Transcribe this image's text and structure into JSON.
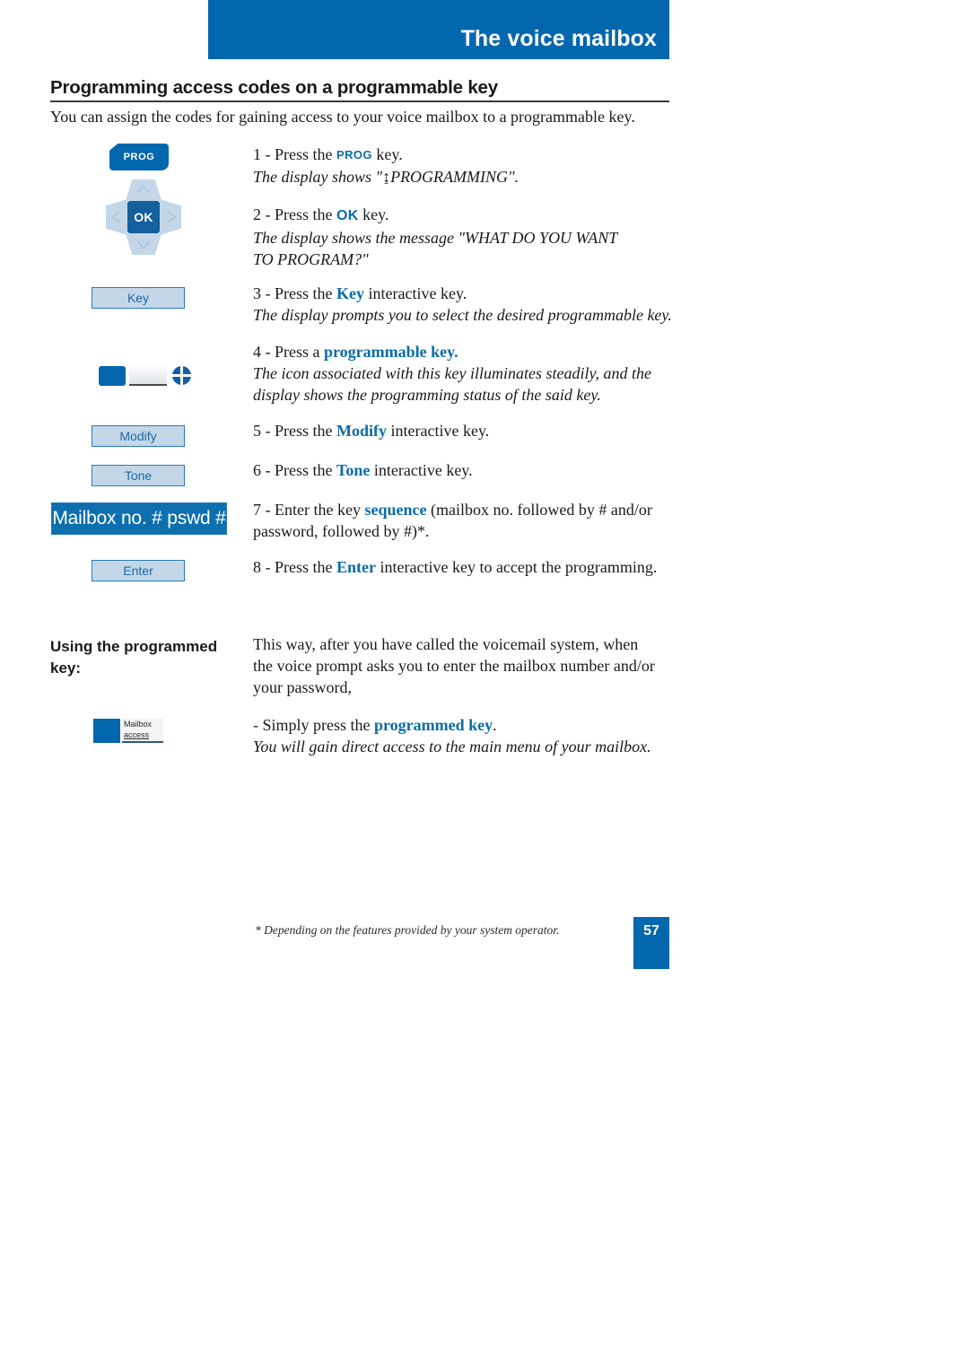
{
  "header": {
    "title": "The voice mailbox",
    "accent_color": "#0267ad"
  },
  "section": {
    "title": "Programming access codes on a programmable key",
    "intro": "You can assign the codes for gaining access to your voice mailbox to a programmable key."
  },
  "icons": {
    "prog_key_label": "PROG",
    "ok_key_label": "OK",
    "nav_up": "up-arrow",
    "nav_down": "down-arrow",
    "nav_left": "left-arrow",
    "nav_right": "right-arrow"
  },
  "softkeys": {
    "key": "Key",
    "modify": "Modify",
    "tone": "Tone",
    "enter": "Enter"
  },
  "display_strip": {
    "text": "Mailbox no. # pswd #"
  },
  "mailbox_key_icon": {
    "line1": "Mailbox",
    "line2": "access"
  },
  "steps": [
    {
      "number": "1",
      "lead_before": "1 - Press the ",
      "inline_key": "PROG",
      "lead_after": " key.",
      "note": "The display shows \"↨PROGRAMMING\"."
    },
    {
      "number": "2",
      "lead_before": "2 - Press the ",
      "inline_key": "OK",
      "lead_after": " key.",
      "note_line1": "The display shows the message \"WHAT DO YOU WANT",
      "note_line2": "TO PROGRAM?\""
    },
    {
      "number": "3",
      "lead_before": "3 - Press the ",
      "keyword": "Key",
      "lead_after": " interactive key.",
      "note": "The display prompts you to select the desired programmable key."
    },
    {
      "number": "4",
      "lead_before": "4 - Press a ",
      "keyword": "programmable key.",
      "lead_after": "",
      "note_line1": "The icon associated with this key illuminates steadily, and the",
      "note_line2": "display shows the programming status of the said key."
    },
    {
      "number": "5",
      "lead_before": "5 - Press the ",
      "keyword": "Modify",
      "lead_after": " interactive key."
    },
    {
      "number": "6",
      "lead_before": "6 - Press the ",
      "keyword": "Tone",
      "lead_after": " interactive key."
    },
    {
      "number": "7",
      "lead_before": "7 - Enter the key ",
      "keyword": "sequence",
      "lead_after": " (mailbox no. followed by # and/or",
      "line2": "password, followed by #)*."
    },
    {
      "number": "8",
      "lead_before": "8 - Press the ",
      "keyword": "Enter",
      "lead_after": " interactive key to accept the programming."
    }
  ],
  "using_section": {
    "heading_line1": "Using the programmed",
    "heading_line2": "key:",
    "body_line1": "This way, after you have called the voicemail system, when",
    "body_line2": "the voice prompt asks you to enter the mailbox number and/or",
    "body_line3": "your password,",
    "bullet_before": "- Simply press the ",
    "bullet_keyword": "programmed key",
    "bullet_after": ".",
    "bullet_note": "You will gain direct access to the main menu of your mailbox."
  },
  "footer": {
    "footnote": "* Depending on the features provided by your system operator.",
    "page_number": "57"
  }
}
